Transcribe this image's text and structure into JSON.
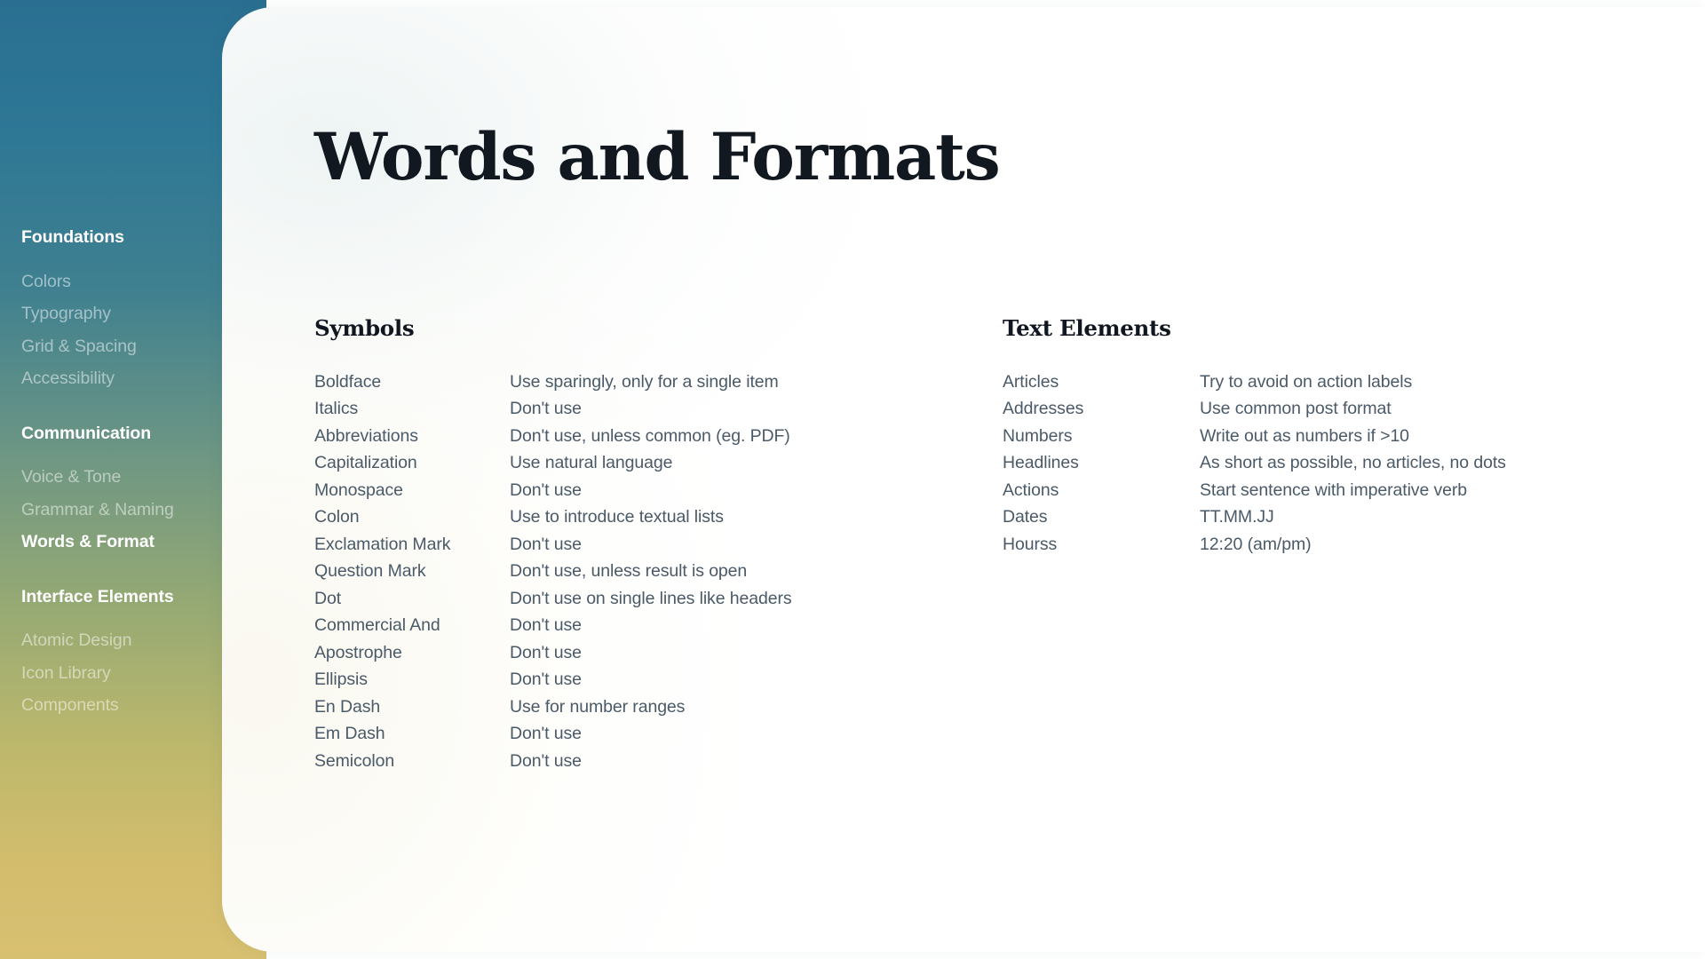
{
  "sidebar": {
    "groups": [
      {
        "heading": "Foundations",
        "items": [
          {
            "label": "Colors",
            "active": false
          },
          {
            "label": "Typography",
            "active": false
          },
          {
            "label": "Grid & Spacing",
            "active": false
          },
          {
            "label": "Accessibility",
            "active": false
          }
        ]
      },
      {
        "heading": "Communication",
        "items": [
          {
            "label": "Voice & Tone",
            "active": false
          },
          {
            "label": "Grammar & Naming",
            "active": false
          },
          {
            "label": "Words & Format",
            "active": true
          }
        ]
      },
      {
        "heading": "Interface Elements",
        "items": [
          {
            "label": "Atomic Design",
            "active": false
          },
          {
            "label": "Icon Library",
            "active": false
          },
          {
            "label": "Components",
            "active": false
          }
        ]
      }
    ]
  },
  "page": {
    "title": "Words and Formats"
  },
  "tables": [
    {
      "title": "Symbols",
      "rows": [
        {
          "key": "Boldface",
          "value": "Use sparingly, only for a single item"
        },
        {
          "key": "Italics",
          "value": "Don't use"
        },
        {
          "key": "Abbreviations",
          "value": "Don't use, unless common (eg. PDF)"
        },
        {
          "key": "Capitalization",
          "value": "Use natural language"
        },
        {
          "key": "Monospace",
          "value": "Don't use"
        },
        {
          "key": "Colon",
          "value": "Use to introduce textual lists"
        },
        {
          "key": "Exclamation Mark",
          "value": "Don't use"
        },
        {
          "key": "Question Mark",
          "value": "Don't use, unless result is open"
        },
        {
          "key": "Dot",
          "value": "Don't use on single lines like headers"
        },
        {
          "key": "Commercial And",
          "value": "Don't use"
        },
        {
          "key": "Apostrophe",
          "value": "Don't use"
        },
        {
          "key": "Ellipsis",
          "value": "Don't use"
        },
        {
          "key": "En Dash",
          "value": "Use for number ranges"
        },
        {
          "key": "Em Dash",
          "value": "Don't use"
        },
        {
          "key": "Semicolon",
          "value": "Don't use"
        }
      ]
    },
    {
      "title": "Text Elements",
      "rows": [
        {
          "key": "Articles",
          "value": "Try to avoid on action labels"
        },
        {
          "key": "Addresses",
          "value": "Use common post format"
        },
        {
          "key": "Numbers",
          "value": "Write out as numbers if >10"
        },
        {
          "key": "Headlines",
          "value": "As short as possible, no articles, no dots"
        },
        {
          "key": "Actions",
          "value": "Start sentence with imperative verb"
        },
        {
          "key": "Dates",
          "value": "TT.MM.JJ"
        },
        {
          "key": "Hourss",
          "value": "12:20 (am/pm)"
        }
      ]
    }
  ],
  "colors": {
    "sidebar_top": "#2a6f91",
    "sidebar_mid": "#8fa77a",
    "sidebar_bottom": "#d8c071",
    "title_text": "#121820",
    "body_text": "#4a5a68",
    "panel_bg": "#ffffff"
  }
}
